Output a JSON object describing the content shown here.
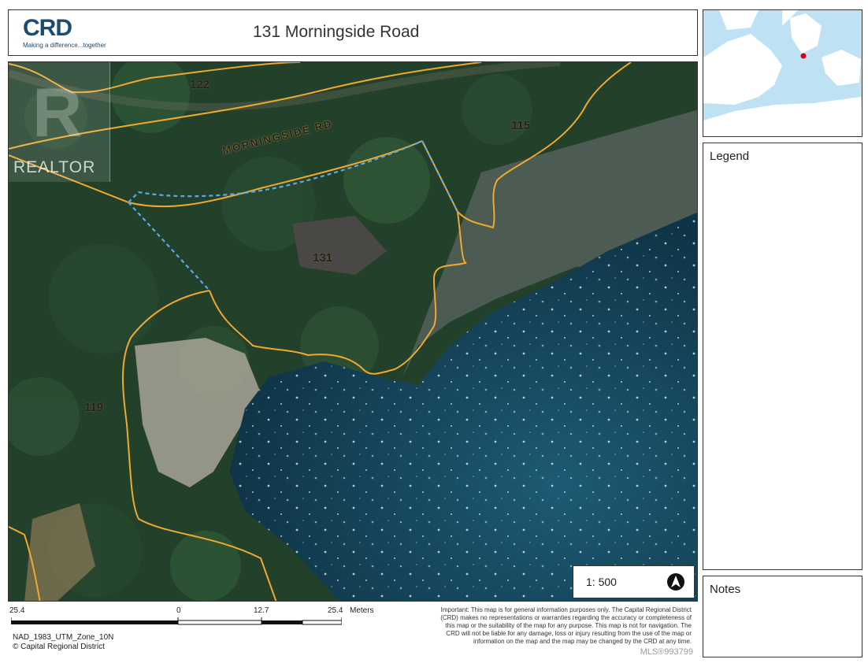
{
  "header": {
    "logo_text": "CRD",
    "logo_tagline": "Making a difference...together",
    "title": "131 Morningside Road"
  },
  "watermark": {
    "text": "REALTOR"
  },
  "map": {
    "road_label": "MORNINGSIDE RD",
    "lot_labels": [
      "122",
      "115",
      "131",
      "119"
    ],
    "colors": {
      "parcel_line": "#f0a830",
      "subject_outline": "#5aa9e6",
      "water": "#123e52",
      "forest": "#1f3a22"
    }
  },
  "inset_map": {
    "colors": {
      "water": "#bfe1f4",
      "land": "#ffffff",
      "marker": "#d0021b"
    }
  },
  "legend": {
    "title": "Legend"
  },
  "notes": {
    "title": "Notes"
  },
  "scale": {
    "ratio": "1: 500",
    "ticks": [
      "25.4",
      "0",
      "12.7",
      "25.4"
    ],
    "unit": "Meters",
    "north_icon": "north-arrow-icon"
  },
  "footer": {
    "datum": "NAD_1983_UTM_Zone_10N",
    "copyright": "© Capital Regional District",
    "disclaimer": "Important: This map is for general information purposes only. The Capital Regional District (CRD) makes no representations or warranties regarding the accuracy or completeness of this map or the suitability of the map for any purpose. This map is not for navigation. The CRD will not be liable for any damage, loss or injury resulting from the use of the map or information on the map and the map may be changed by the CRD at any time.",
    "mls": "MLS®993799"
  }
}
